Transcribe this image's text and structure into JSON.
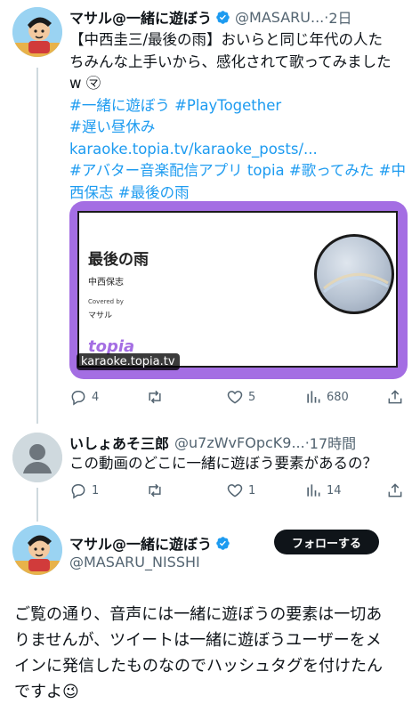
{
  "tweet1": {
    "name": "マサル@一緒に遊ぼう",
    "handle": "@MASARU...",
    "time": "2日",
    "text_line1": "【中西圭三/最後の雨】おいらと同じ年代の人た",
    "text_line2": "ちみんな上手いから、感化されて歌ってみました",
    "text_line3": "w ㋮",
    "hashtags_line1": "#一緒に遊ぼう #PlayTogether",
    "hashtags_line2": "#遅い昼休み",
    "link": "karaoke.topia.tv/karaoke_posts/...",
    "hashtags_line3": "#アバター音楽配信アプリ topia #歌ってみた #中",
    "hashtags_line4": "西保志 #最後の雨",
    "card": {
      "title": "最後の雨",
      "artist": "中西保志",
      "covered_label": "Covered by",
      "singer": "マサル",
      "logo": "topia",
      "domain": "karaoke.topia.tv"
    },
    "replies": "4",
    "retweets": "",
    "likes": "5",
    "views": "680"
  },
  "tweet2": {
    "name": "いしょあそ三郎",
    "handle": "@u7zWvFOpcK9...",
    "time": "17時間",
    "text": "この動画のどこに一緒に遊ぼう要素があるの？",
    "replies": "1",
    "retweets": "",
    "likes": "1",
    "views": "14"
  },
  "tweet3": {
    "name": "マサル@一緒に遊ぼう",
    "handle": "@MASARU_NISSHI",
    "follow_label": "フォローする",
    "text_line1": "ご覧の通り、音声には一緒に遊ぼうの要素は一切あ",
    "text_line2": "りませんが、ツイートは一緒に遊ぼうユーザーをメ",
    "text_line3": "インに発信したものなのでハッシュタグを付けたん",
    "text_line4": "ですよ😉"
  },
  "colors": {
    "link": "#1d9bf0",
    "verified": "#1d9bf0",
    "card_border": "#a46ee3",
    "muted": "#536471"
  }
}
